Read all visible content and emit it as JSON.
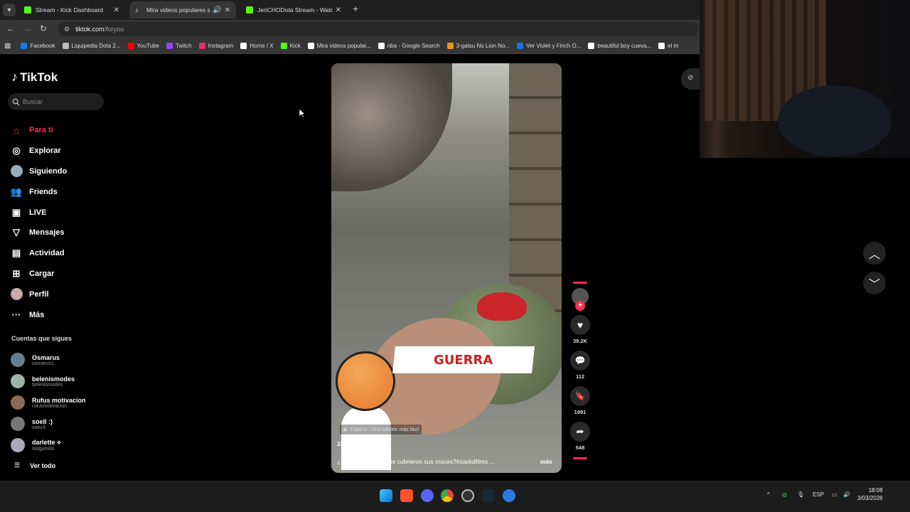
{
  "browser": {
    "tabs": [
      {
        "title": "Stream - Kick Dashboard",
        "favicon": "kick-icon"
      },
      {
        "title": "Mira videos populares sele",
        "favicon": "tiktok-icon",
        "active": true
      },
      {
        "title": "JeriCHODota Stream - Watch Li",
        "favicon": "kick-icon"
      }
    ],
    "url_host": "tiktok.com",
    "url_path": "/foryou",
    "bookmarks": [
      {
        "label": "Facebook",
        "color": "#1877f2"
      },
      {
        "label": "Liquipedia Dota 2...",
        "color": "#bbbbbb"
      },
      {
        "label": "YouTube",
        "color": "#ff0000"
      },
      {
        "label": "Twitch",
        "color": "#9146ff"
      },
      {
        "label": "Instagram",
        "color": "#e1306c"
      },
      {
        "label": "Home / X",
        "color": "#ffffff"
      },
      {
        "label": "Kick",
        "color": "#53fc18"
      },
      {
        "label": "Mira videos popular...",
        "color": "#ffffff"
      },
      {
        "label": "nba - Google Search",
        "color": "#ffffff"
      },
      {
        "label": "3-gatsu No Lion No...",
        "color": "#f09020"
      },
      {
        "label": "Ver Violet y Finch O...",
        "color": "#1a73e8"
      },
      {
        "label": "beautiful boy cueva...",
        "color": "#ffffff"
      },
      {
        "label": "el m",
        "color": "#ffffff"
      }
    ]
  },
  "tiktok": {
    "logo": "TikTok",
    "search_placeholder": "Buscar",
    "nav": [
      {
        "label": "Para ti",
        "icon": "home-icon",
        "active": true
      },
      {
        "label": "Explorar",
        "icon": "compass-icon"
      },
      {
        "label": "Siguiendo",
        "icon": "following-avatar-icon"
      },
      {
        "label": "Friends",
        "icon": "friends-icon"
      },
      {
        "label": "LIVE",
        "icon": "live-icon"
      },
      {
        "label": "Mensajes",
        "icon": "send-icon"
      },
      {
        "label": "Actividad",
        "icon": "activity-icon"
      },
      {
        "label": "Cargar",
        "icon": "upload-icon"
      },
      {
        "label": "Perfil",
        "icon": "profile-avatar-icon"
      },
      {
        "label": "Más",
        "icon": "more-icon"
      }
    ],
    "following_heading": "Cuentas que sigues",
    "following": [
      {
        "name": "Osmarus",
        "user": "osmarus1"
      },
      {
        "name": "belenismodes",
        "user": "belenismodes"
      },
      {
        "name": "Rufus motivacion",
        "user": "rufusmotivacion"
      },
      {
        "name": "soell :)",
        "user": "soez3"
      },
      {
        "name": "darlette ⟡",
        "user": "notgumita"
      }
    ],
    "see_all": "Ver todo",
    "video": {
      "overlay_text": "GUERRA",
      "capcut": "CapCut · Una edición más fácil",
      "username": "zackdfilms897",
      "description": "¿Por qué los médicos cubrieron sus cruces?#zackdfilms ...",
      "more": "más"
    },
    "actions": {
      "likes": "39.2K",
      "comments": "112",
      "saves": "1991",
      "shares": "548"
    }
  },
  "taskbar": {
    "lang": "ESP",
    "time": "18:08",
    "date": "3/03/2026"
  }
}
